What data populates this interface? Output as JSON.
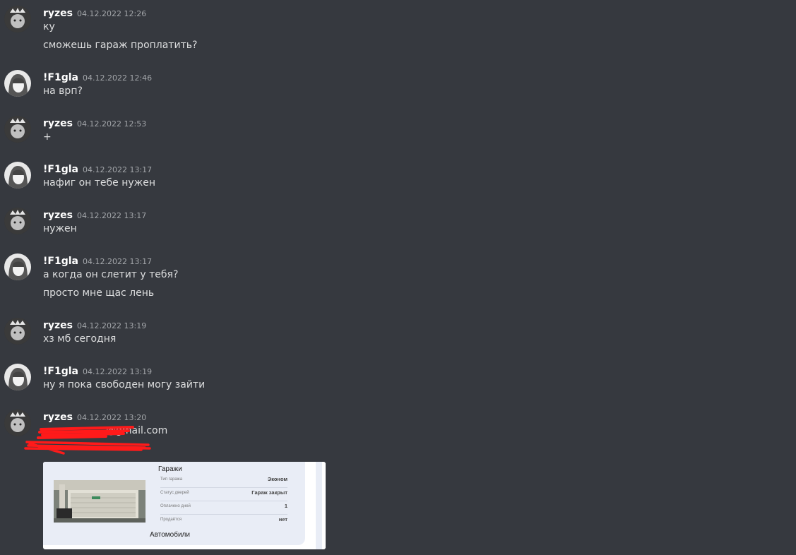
{
  "messages": [
    {
      "user": "ryzes",
      "time": "04.12.2022 12:26",
      "lines": [
        "ку",
        "сможешь гараж проплатить?"
      ]
    },
    {
      "user": "!F1gla",
      "time": "04.12.2022 12:46",
      "lines": [
        "на врп?"
      ]
    },
    {
      "user": "ryzes",
      "time": "04.12.2022 12:53",
      "lines": [
        "+"
      ]
    },
    {
      "user": "!F1gla",
      "time": "04.12.2022 13:17",
      "lines": [
        "нафиг он тебе нужен"
      ]
    },
    {
      "user": "ryzes",
      "time": "04.12.2022 13:17",
      "lines": [
        "нужен"
      ]
    },
    {
      "user": "!F1gla",
      "time": "04.12.2022 13:17",
      "lines": [
        "а когда он слетит у тебя?",
        "просто мне щас лень"
      ]
    },
    {
      "user": "ryzes",
      "time": "04.12.2022 13:19",
      "lines": [
        "хз мб сегодня"
      ]
    },
    {
      "user": "!F1gla",
      "time": "04.12.2022 13:19",
      "lines": [
        "ну я пока свободен могу зайти"
      ]
    },
    {
      "user": "ryzes",
      "time": "04.12.2022 13:20",
      "lines": [
        "@gmail.com"
      ]
    }
  ],
  "colors": {
    "redaction": "#ff1a1a",
    "background": "#36393f"
  },
  "attachment": {
    "title": "Гаражи",
    "rows": [
      {
        "key": "Тип гаража",
        "value": "Эконом"
      },
      {
        "key": "Статус дверей",
        "value": "Гараж закрыт"
      },
      {
        "key": "Оплачено дней",
        "value": "1"
      },
      {
        "key": "Продаётся",
        "value": "нет"
      }
    ],
    "footer": "Автомобили"
  }
}
